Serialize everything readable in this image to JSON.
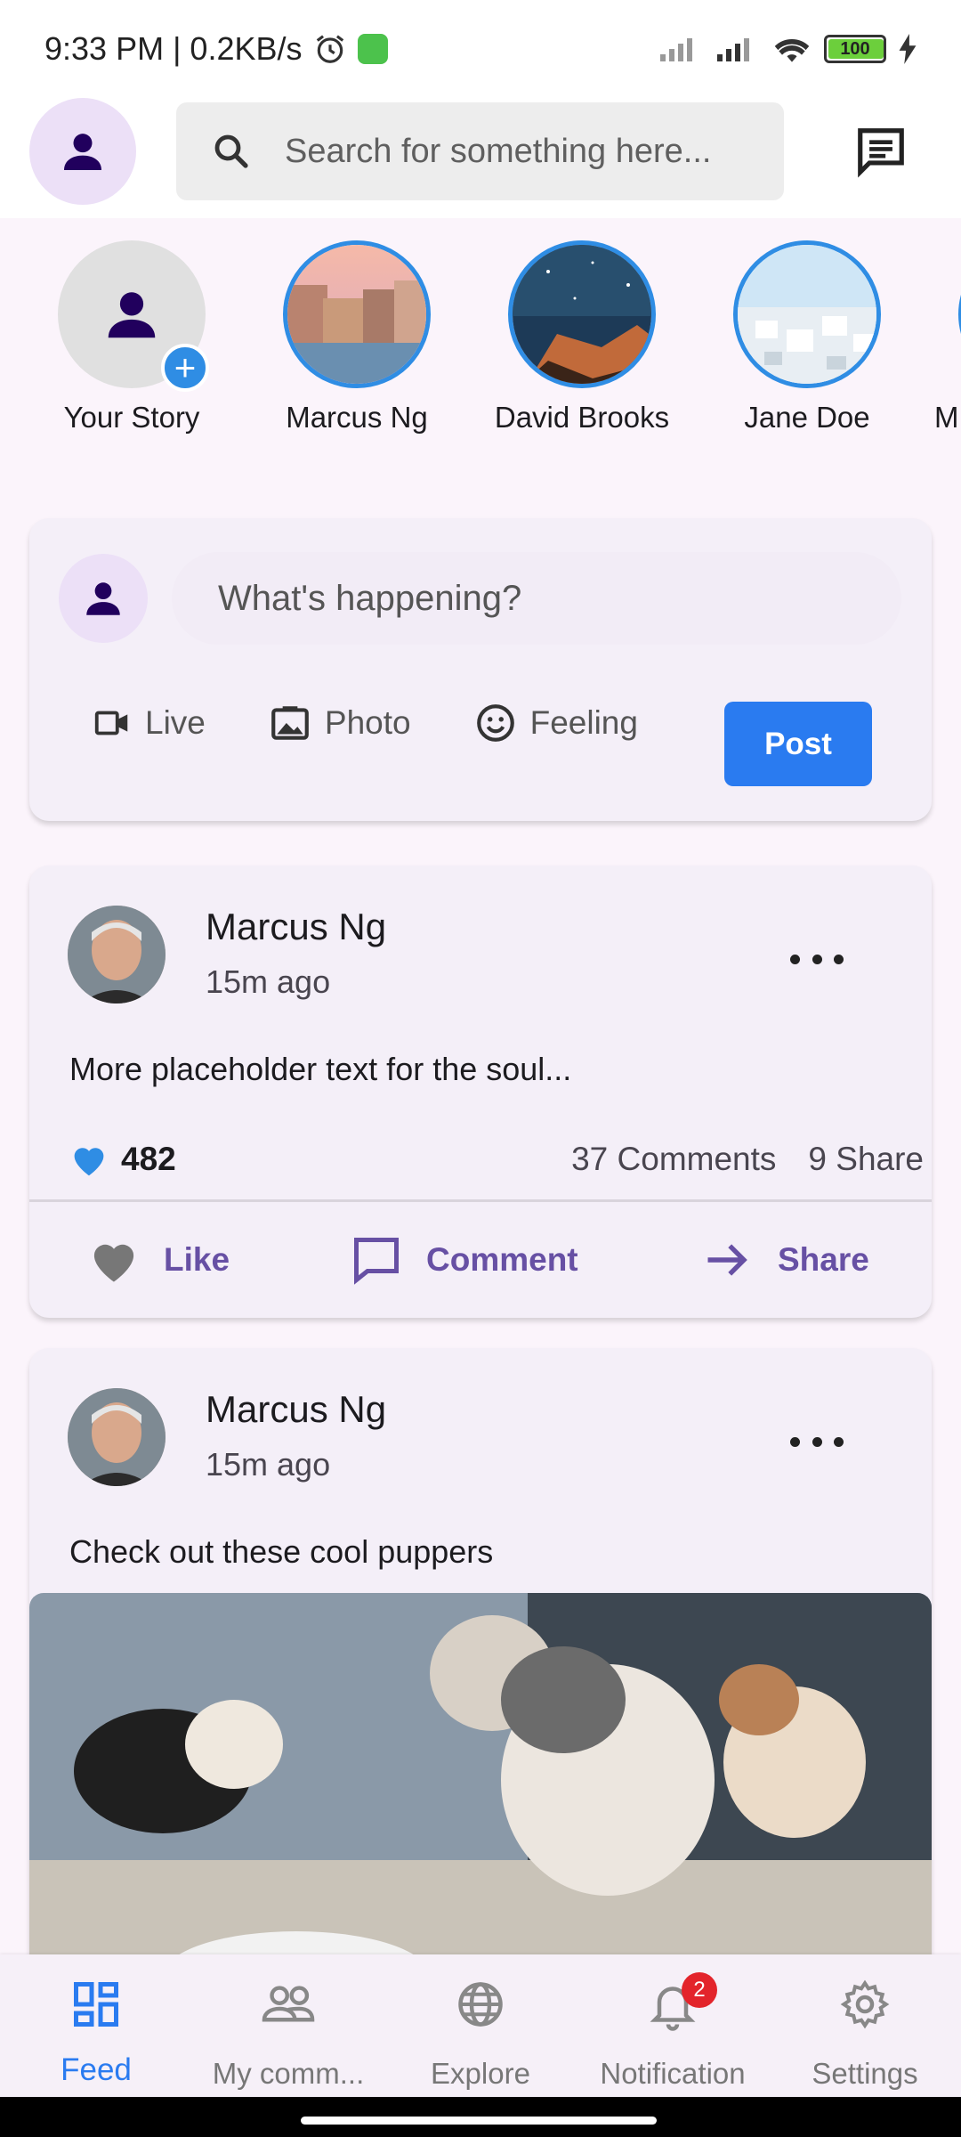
{
  "status_bar": {
    "time_speed": "9:33 PM | 0.2KB/s",
    "battery_level": "100"
  },
  "app_bar": {
    "search_placeholder": "Search for something here..."
  },
  "stories": [
    {
      "name": "Your Story"
    },
    {
      "name": "Marcus Ng"
    },
    {
      "name": "David Brooks"
    },
    {
      "name": "Jane Doe"
    },
    {
      "name": "M"
    }
  ],
  "composer": {
    "prompt": "What's happening?",
    "actions": {
      "live": "Live",
      "photo": "Photo",
      "feeling": "Feeling"
    },
    "post_label": "Post"
  },
  "posts": [
    {
      "author": "Marcus Ng",
      "time": "15m ago",
      "text": "More placeholder text for the soul...",
      "likes": "482",
      "comments": "37 Comments",
      "shares": "9 Share",
      "like_label": "Like",
      "comment_label": "Comment",
      "share_label": "Share"
    },
    {
      "author": "Marcus Ng",
      "time": "15m ago",
      "text": "Check out these cool puppers"
    }
  ],
  "bottom_nav": [
    {
      "label": "Feed"
    },
    {
      "label": "My comm..."
    },
    {
      "label": "Explore"
    },
    {
      "label": "Notification",
      "badge": "2"
    },
    {
      "label": "Settings"
    }
  ],
  "colors": {
    "accent": "#2a7bf0",
    "action_purple": "#6750a4",
    "story_ring": "#2f8de4",
    "badge": "#e3242b"
  }
}
